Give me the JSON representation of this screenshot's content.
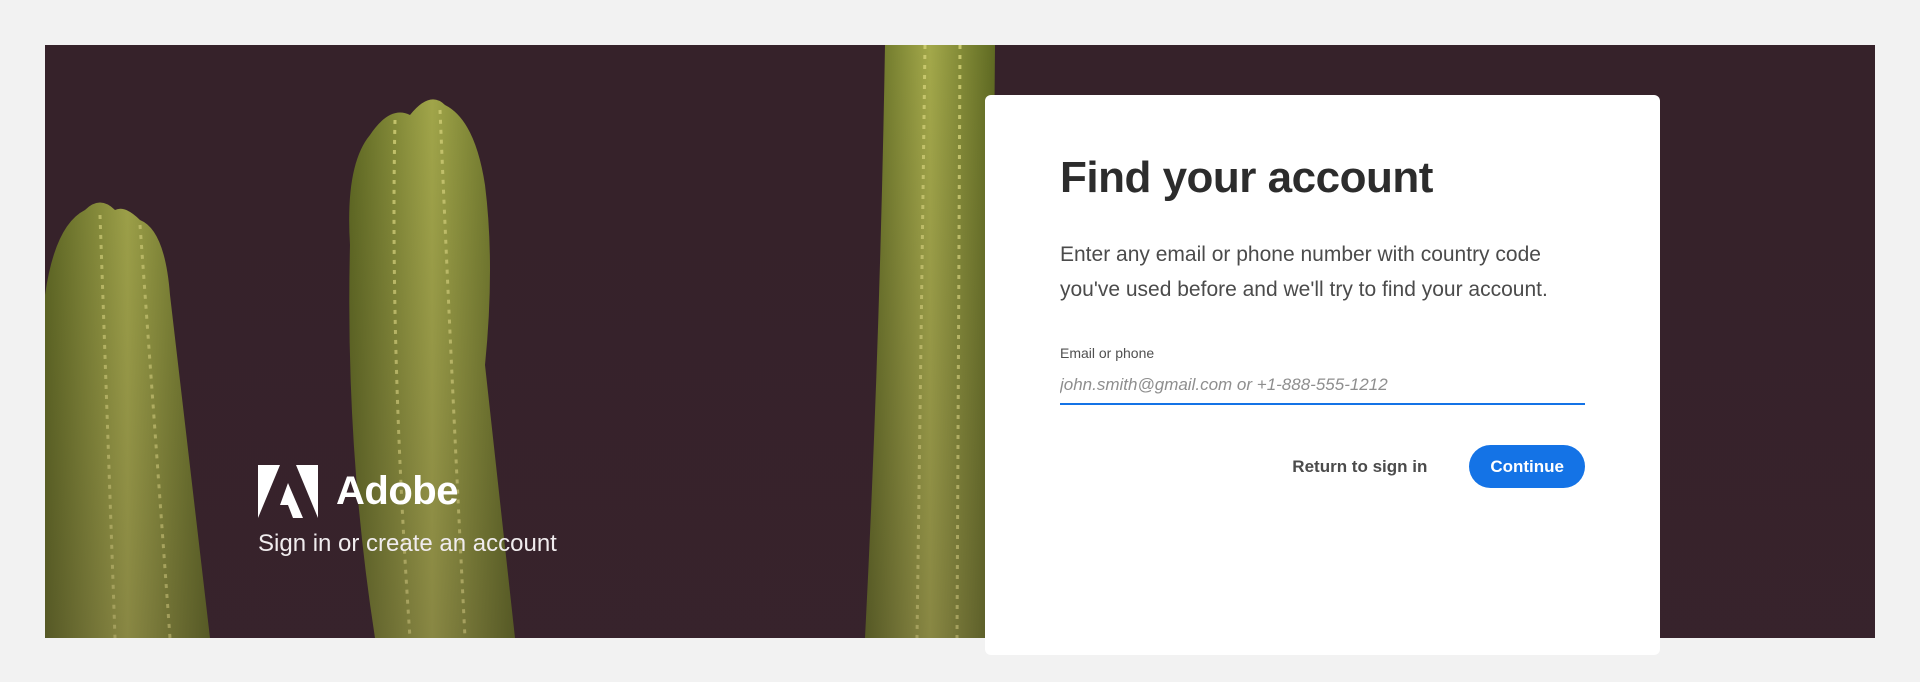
{
  "brand": {
    "name": "Adobe",
    "tagline": "Sign in or create an account"
  },
  "card": {
    "title": "Find your account",
    "description": "Enter any email or phone number with country code you've used before and we'll try to find your account.",
    "field": {
      "label": "Email or phone",
      "value": "",
      "placeholder": "john.smith@gmail.com or +1-888-555-1212"
    },
    "return_label": "Return to sign in",
    "continue_label": "Continue"
  },
  "colors": {
    "accent": "#1473e6",
    "background": "#36222a",
    "cactus": "#8d9432"
  },
  "icons": [
    "adobe-logo-icon"
  ]
}
